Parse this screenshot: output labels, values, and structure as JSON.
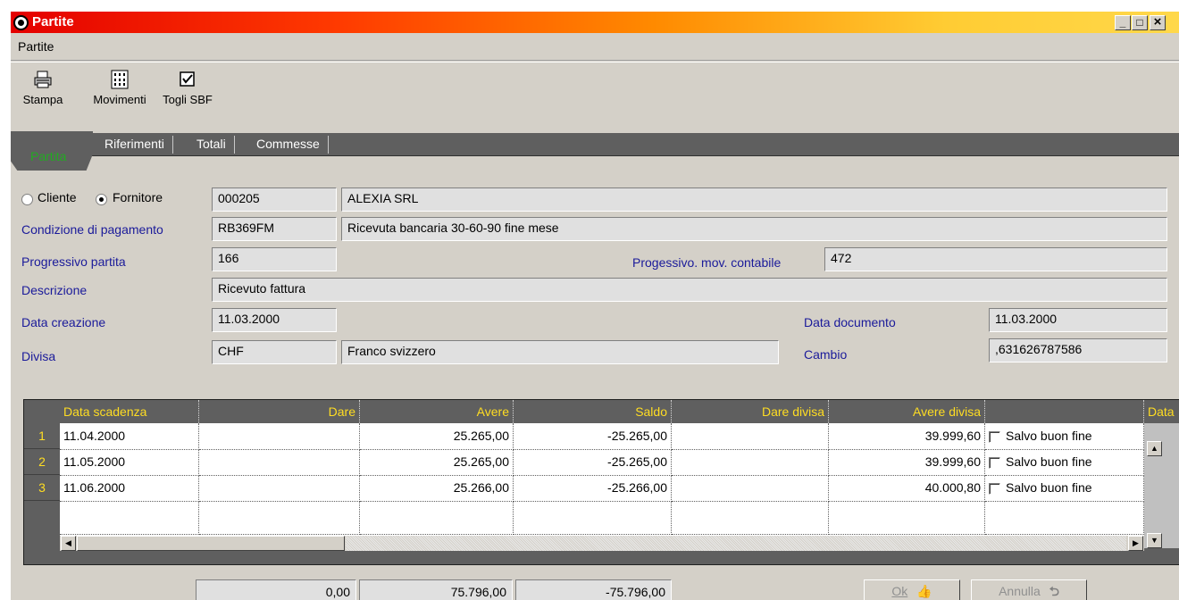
{
  "window": {
    "title": "Partite",
    "btn_min": "_",
    "btn_max": "□",
    "btn_close": "×"
  },
  "menu": {
    "partite": "Partite"
  },
  "toolbar": {
    "stampa": "Stampa",
    "movimenti": "Movimenti",
    "togli_sbf": "Togli SBF"
  },
  "tabs": {
    "partita": "Partita",
    "riferimenti": "Riferimenti",
    "totali": "Totali",
    "commesse": "Commesse"
  },
  "form": {
    "cliente_label": "Cliente",
    "fornitore_label": "Fornitore",
    "selected": "Fornitore",
    "codice": "000205",
    "ragione_sociale": "ALEXIA SRL",
    "cond_pag_label": "Condizione di pagamento",
    "cond_pag_code": "RB369FM",
    "cond_pag_desc": "Ricevuta bancaria 30-60-90 fine mese",
    "prog_partita_label": "Progressivo partita",
    "prog_partita": "166",
    "prog_mov_label": "Progessivo. mov. contabile",
    "prog_mov": "472",
    "descrizione_label": "Descrizione",
    "descrizione": "Ricevuto fattura",
    "data_creazione_label": "Data creazione",
    "data_creazione": "11.03.2000",
    "data_documento_label": "Data documento",
    "data_documento": "11.03.2000",
    "divisa_label": "Divisa",
    "divisa_code": "CHF",
    "divisa_desc": "Franco svizzero",
    "cambio_label": "Cambio",
    "cambio": ",631626787586"
  },
  "grid": {
    "headers": {
      "data_scadenza": "Data scadenza",
      "dare": "Dare",
      "avere": "Avere",
      "saldo": "Saldo",
      "dare_divisa": "Dare divisa",
      "avere_divisa": "Avere divisa",
      "data": "Data"
    },
    "rows": [
      {
        "n": "1",
        "data": "11.04.2000",
        "dare": "",
        "avere": "25.265,00",
        "saldo": "-25.265,00",
        "dare_divisa": "",
        "avere_divisa": "39.999,60",
        "sbf": "Salvo buon fine"
      },
      {
        "n": "2",
        "data": "11.05.2000",
        "dare": "",
        "avere": "25.265,00",
        "saldo": "-25.265,00",
        "dare_divisa": "",
        "avere_divisa": "39.999,60",
        "sbf": "Salvo buon fine"
      },
      {
        "n": "3",
        "data": "11.06.2000",
        "dare": "",
        "avere": "25.266,00",
        "saldo": "-25.266,00",
        "dare_divisa": "",
        "avere_divisa": "40.000,80",
        "sbf": "Salvo buon fine"
      }
    ]
  },
  "totals": {
    "dare": "0,00",
    "avere": "75.796,00",
    "saldo": "-75.796,00"
  },
  "buttons": {
    "ok": "Ok",
    "annulla": "Annulla"
  }
}
